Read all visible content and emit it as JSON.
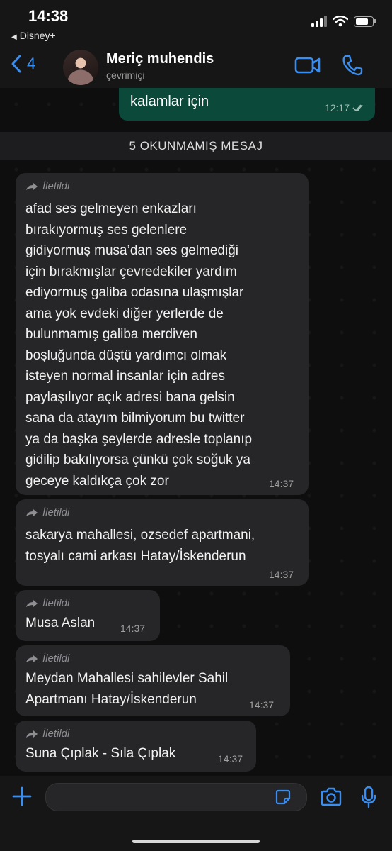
{
  "status_bar": {
    "time": "14:38",
    "back_app": "Disney+"
  },
  "header": {
    "back_count": "4",
    "contact_name": "Meriç muhendis",
    "contact_status": "çevrimiçi",
    "icons": [
      "video-call-icon",
      "voice-call-icon"
    ]
  },
  "chat": {
    "outgoing": {
      "text": "kalamlar için",
      "time": "12:17",
      "status_icon": "double-check-icon"
    },
    "unread_banner": "5 OKUNMAMIŞ MESAJ",
    "forwarded_label": "İletildi",
    "messages": [
      {
        "text": "afad ses gelmeyen enkazları\nbırakıyormuş ses gelenlere\ngidiyormuş musa’dan ses gelmediği\niçin bırakmışlar çevredekiler yardım\nediyormuş galiba odasına ulaşmışlar\nama yok evdeki diğer yerlerde de\nbulunmamış galiba merdiven\nboşluğunda düştü yardımcı olmak\nisteyen normal insanlar  için adres\npaylaşılıyor açık adresi bana gelsin\nsana da atayım bilmiyorum bu twitter\nya da başka şeylerde adresle toplanıp\ngidilip bakılıyorsa çünkü çok soğuk ya\ngeceye kaldıkça çok zor",
        "time": "14:37"
      },
      {
        "text": "sakarya mahallesi, ozsedef apartmani,\ntosyalı cami arkası Hatay/İskenderun",
        "time": "14:37"
      },
      {
        "text": "Musa Aslan",
        "time": "14:37"
      },
      {
        "text": "Meydan Mahallesi sahilevler Sahil\nApartmanı Hatay/İskenderun",
        "time": "14:37"
      },
      {
        "text": "Suna Çıplak - Sıla Çıplak",
        "time": "14:37"
      }
    ]
  },
  "composer": {
    "placeholder": "",
    "icons": [
      "plus-icon",
      "sticker-icon",
      "camera-icon",
      "microphone-icon"
    ]
  },
  "colors": {
    "accent": "#3a8ef0",
    "outgoing_bubble": "#0b4a3b",
    "incoming_bubble": "#262628"
  }
}
